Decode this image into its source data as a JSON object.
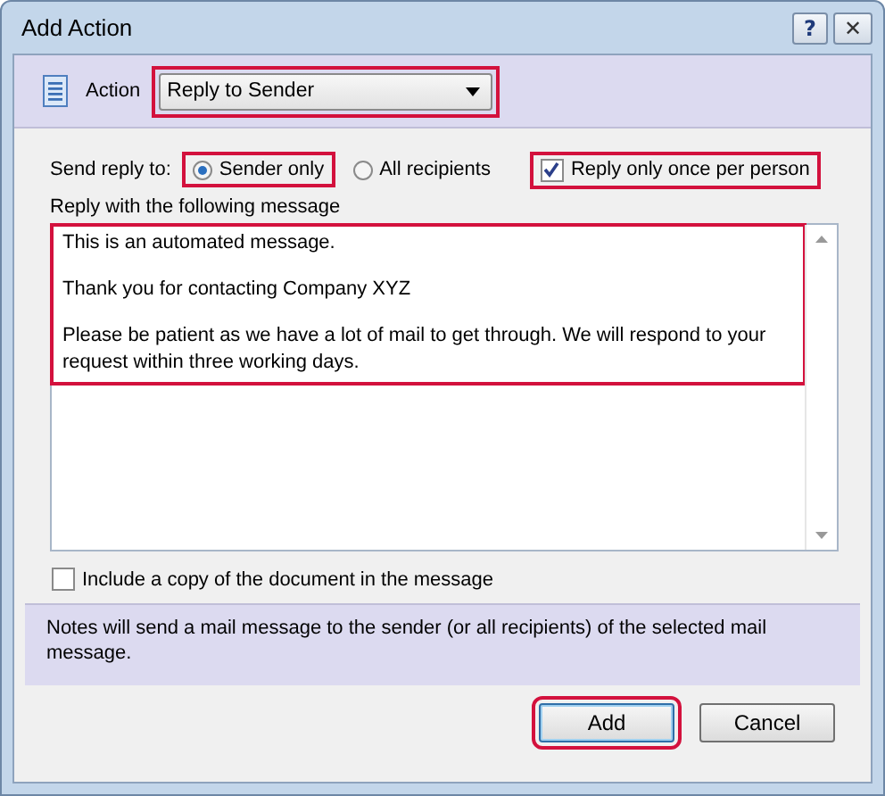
{
  "window": {
    "title": "Add Action",
    "controls": [
      {
        "kind": "help",
        "label": "?"
      },
      {
        "kind": "close",
        "label": "✕"
      }
    ]
  },
  "action": {
    "label": "Action",
    "value": "Reply to Sender",
    "highlighted": true
  },
  "send_reply_to": {
    "label": "Send reply to:",
    "options": [
      {
        "label": "Sender only",
        "selected": true,
        "highlighted": true
      },
      {
        "label": "All recipients",
        "selected": false,
        "highlighted": false
      }
    ]
  },
  "reply_once": {
    "label": "Reply only once per person",
    "checked": true,
    "highlighted": true
  },
  "message": {
    "label": "Reply with the following message",
    "highlighted": true,
    "paragraphs": [
      "This is an automated message.",
      "Thank you for contacting Company XYZ",
      "Please be patient as we have a lot of mail to get through. We will respond to your request within three working days."
    ]
  },
  "include_copy": {
    "label": "Include a copy of the document in the message",
    "checked": false
  },
  "notes": "Notes will send a mail message to the sender (or all recipients) of the selected mail message.",
  "buttons": [
    {
      "label": "Add",
      "highlighted": true
    },
    {
      "label": "Cancel",
      "highlighted": false
    }
  ]
}
